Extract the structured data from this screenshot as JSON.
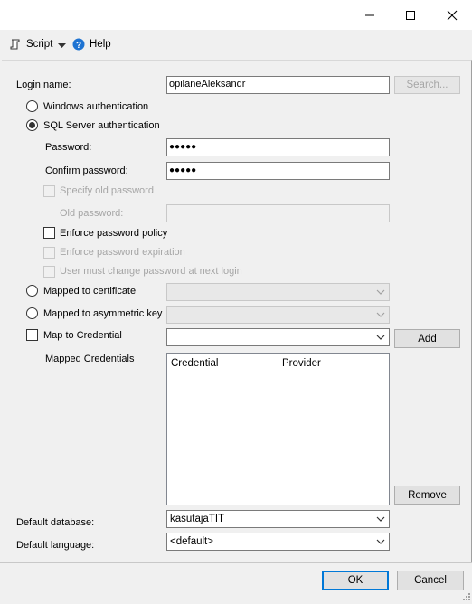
{
  "toolbar": {
    "script_label": "Script",
    "help_label": "Help"
  },
  "login": {
    "label": "Login name:",
    "value": "opilaneAleksandr",
    "search_label": "Search..."
  },
  "auth": {
    "windows_label": "Windows authentication",
    "sql_label": "SQL Server authentication",
    "password_label": "Password:",
    "password_value": "●●●●●",
    "confirm_label": "Confirm password:",
    "confirm_value": "●●●●●",
    "specify_old_label": "Specify old password",
    "old_password_label": "Old password:",
    "enforce_policy_label": "Enforce password policy",
    "enforce_expiration_label": "Enforce password expiration",
    "must_change_label": "User must change password at next login",
    "selected": "sql"
  },
  "mapped": {
    "certificate_label": "Mapped to certificate",
    "asymmetric_label": "Mapped to asymmetric key",
    "credential_label": "Map to Credential",
    "add_label": "Add",
    "mapped_credentials_label": "Mapped Credentials",
    "columns": [
      "Credential",
      "Provider"
    ],
    "remove_label": "Remove"
  },
  "defaults": {
    "database_label": "Default database:",
    "database_value": "kasutajaTIT",
    "language_label": "Default language:",
    "language_value": "<default>"
  },
  "buttons": {
    "ok_label": "OK",
    "cancel_label": "Cancel"
  },
  "colors": {
    "accent": "#0078d7",
    "background": "#f0f0f0"
  }
}
